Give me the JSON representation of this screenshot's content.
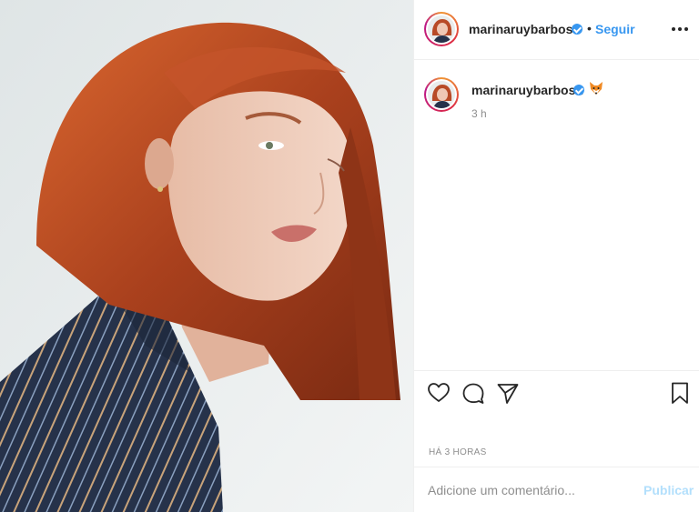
{
  "post": {
    "username": "marinaruybarbosa",
    "verified": true,
    "follow_label": "Seguir",
    "separator": "•",
    "more_icon": "more-options-icon",
    "photo_icon": "portrait-photo"
  },
  "caption": {
    "username": "marinaruybarbosa",
    "emoji": "🦊",
    "time_short": "3 h"
  },
  "actions": {
    "icons": [
      "heart-icon",
      "comment-icon",
      "share-icon",
      "bookmark-icon"
    ],
    "time_long": "HÁ 3 HORAS"
  },
  "comment": {
    "placeholder": "Adicione um comentário...",
    "publish_label": "Publicar"
  },
  "colors": {
    "accent": "#3897f0",
    "publish_disabled": "#b2dffc",
    "muted": "#8e8e8e",
    "hair": "#b84a26"
  }
}
